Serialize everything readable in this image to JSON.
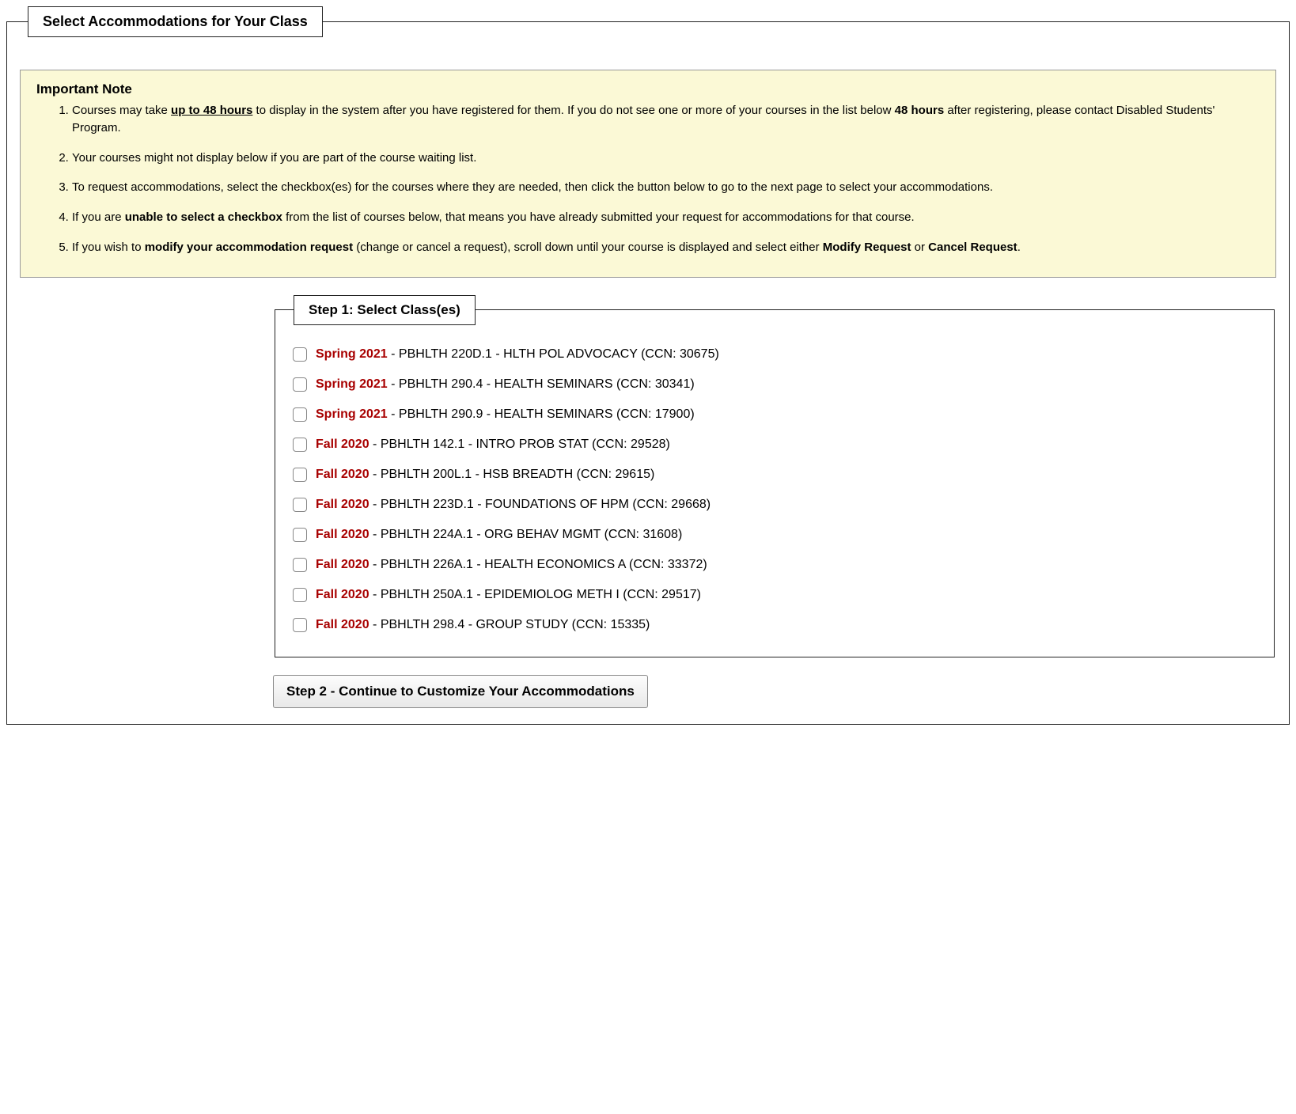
{
  "main": {
    "legend": "Select Accommodations for Your Class",
    "note": {
      "title": "Important Note",
      "items": [
        {
          "html": "Courses may take <span class='bold underline'>up to 48 hours</span> to display in the system after you have registered for them. If you do not see one or more of your courses in the list below <span class='bold'>48 hours</span> after registering, please contact Disabled Students' Program."
        },
        {
          "html": "Your courses might not display below if you are part of the course waiting list."
        },
        {
          "html": "To request accommodations, select the checkbox(es) for the courses where they are needed, then click the button below to go to the next page to select your accommodations."
        },
        {
          "html": "If you are <span class='bold'>unable to select a checkbox</span> from the list of courses below, that means you have already submitted your request for accommodations for that course."
        },
        {
          "html": "If you wish to <span class='bold'>modify your accommodation request</span> (change or cancel a request), scroll down until your course is displayed and select either <span class='bold'>Modify Request</span> or <span class='bold'>Cancel Request</span>."
        }
      ]
    },
    "step1": {
      "legend": "Step 1: Select Class(es)",
      "classes": [
        {
          "term": "Spring 2021",
          "rest": " - PBHLTH 220D.1 - HLTH POL ADVOCACY (CCN: 30675)"
        },
        {
          "term": "Spring 2021",
          "rest": " - PBHLTH 290.4 - HEALTH SEMINARS (CCN: 30341)"
        },
        {
          "term": "Spring 2021",
          "rest": " - PBHLTH 290.9 - HEALTH SEMINARS (CCN: 17900)"
        },
        {
          "term": "Fall 2020",
          "rest": " - PBHLTH 142.1 - INTRO PROB STAT (CCN: 29528)"
        },
        {
          "term": "Fall 2020",
          "rest": " - PBHLTH 200L.1 - HSB BREADTH (CCN: 29615)"
        },
        {
          "term": "Fall 2020",
          "rest": " - PBHLTH 223D.1 - FOUNDATIONS OF HPM (CCN: 29668)"
        },
        {
          "term": "Fall 2020",
          "rest": " - PBHLTH 224A.1 - ORG BEHAV MGMT (CCN: 31608)"
        },
        {
          "term": "Fall 2020",
          "rest": " - PBHLTH 226A.1 - HEALTH ECONOMICS A (CCN: 33372)"
        },
        {
          "term": "Fall 2020",
          "rest": " - PBHLTH 250A.1 - EPIDEMIOLOG METH I (CCN: 29517)"
        },
        {
          "term": "Fall 2020",
          "rest": " - PBHLTH 298.4 - GROUP STUDY (CCN: 15335)"
        }
      ]
    },
    "continue_label": "Step 2 - Continue to Customize Your Accommodations"
  }
}
